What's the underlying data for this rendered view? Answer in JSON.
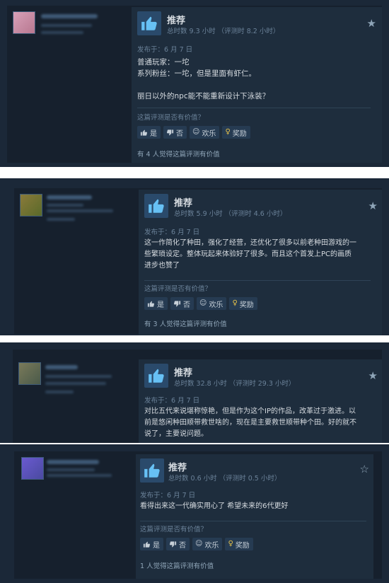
{
  "reviews": [
    {
      "verdict": "推荐",
      "hours": "总时数 9.3 小时 （评测时 8.2 小时）",
      "posted": "发布于：6 月 7 日",
      "body": "普通玩家：一坨\n系列粉丝：一坨，但是里面有虾仁。\n\n丽日以外的npc能不能重新设计下泳装？",
      "helpful_q": "这篇评测是否有价值？",
      "yes": "是",
      "no": "否",
      "funny": "欢乐",
      "award": "奖励",
      "found": "有 4 人觉得这篇评测有价值",
      "avatar_color": "#c98aa3",
      "starred": true
    },
    {
      "verdict": "推荐",
      "hours": "总时数 5.9 小时 （评测时 4.6 小时）",
      "posted": "发布于：6 月 7 日",
      "body": "这一作简化了种田，强化了经营，还优化了很多以前老种田游戏的一\n些繁琐设定。整体玩起来体验好了很多。而且这个首发上PC的画质\n进步也赞了",
      "helpful_q": "这篇评测是否有价值？",
      "yes": "是",
      "no": "否",
      "funny": "欢乐",
      "award": "奖励",
      "found": "有 3 人觉得这篇评测有价值",
      "avatar_color": "#7a6a3a",
      "starred": true
    },
    {
      "verdict": "推荐",
      "hours": "总时数 32.8 小时 （评测时 29.3 小时）",
      "posted": "发布于：6 月 7 日",
      "body": "对比五代来说堪称惊艳，但是作为这个IP的作品，改革过于激进。以\n前是悠闲种田顺带救世啥的，现在是主要救世顺带种个田。好的就不\n说了，主要说问题。",
      "avatar_color": "#6a6a5a",
      "starred": true
    },
    {
      "verdict": "推荐",
      "hours": "总时数 0.6 小时 （评测时 0.5 小时）",
      "posted": "发布于：6 月 7 日",
      "body": "看得出来这一代确实用心了 希望未来的6代更好",
      "helpful_q": "这篇评测是否有价值？",
      "yes": "是",
      "no": "否",
      "funny": "欢乐",
      "award": "奖励",
      "found": "1 人觉得这篇评测有价值",
      "avatar_color": "#5a5ab0",
      "starred": false
    }
  ]
}
